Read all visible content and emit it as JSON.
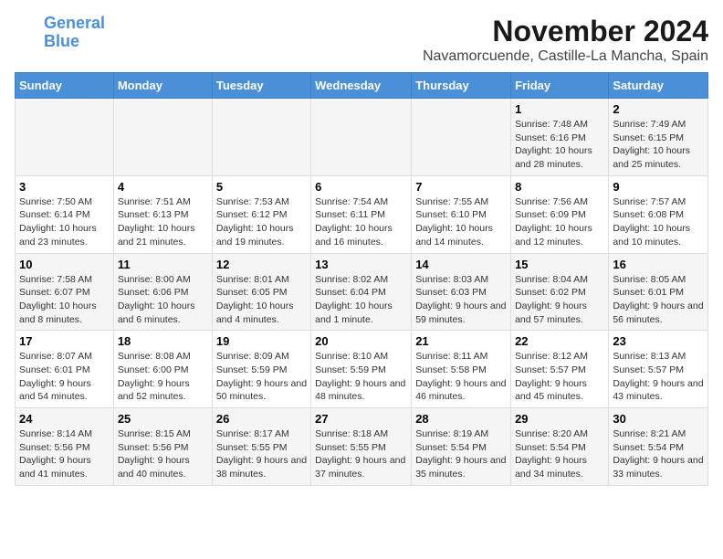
{
  "logo": {
    "line1": "General",
    "line2": "Blue"
  },
  "title": "November 2024",
  "subtitle": "Navamorcuende, Castille-La Mancha, Spain",
  "weekdays": [
    "Sunday",
    "Monday",
    "Tuesday",
    "Wednesday",
    "Thursday",
    "Friday",
    "Saturday"
  ],
  "weeks": [
    [
      {
        "day": "",
        "info": ""
      },
      {
        "day": "",
        "info": ""
      },
      {
        "day": "",
        "info": ""
      },
      {
        "day": "",
        "info": ""
      },
      {
        "day": "",
        "info": ""
      },
      {
        "day": "1",
        "info": "Sunrise: 7:48 AM\nSunset: 6:16 PM\nDaylight: 10 hours and 28 minutes."
      },
      {
        "day": "2",
        "info": "Sunrise: 7:49 AM\nSunset: 6:15 PM\nDaylight: 10 hours and 25 minutes."
      }
    ],
    [
      {
        "day": "3",
        "info": "Sunrise: 7:50 AM\nSunset: 6:14 PM\nDaylight: 10 hours and 23 minutes."
      },
      {
        "day": "4",
        "info": "Sunrise: 7:51 AM\nSunset: 6:13 PM\nDaylight: 10 hours and 21 minutes."
      },
      {
        "day": "5",
        "info": "Sunrise: 7:53 AM\nSunset: 6:12 PM\nDaylight: 10 hours and 19 minutes."
      },
      {
        "day": "6",
        "info": "Sunrise: 7:54 AM\nSunset: 6:11 PM\nDaylight: 10 hours and 16 minutes."
      },
      {
        "day": "7",
        "info": "Sunrise: 7:55 AM\nSunset: 6:10 PM\nDaylight: 10 hours and 14 minutes."
      },
      {
        "day": "8",
        "info": "Sunrise: 7:56 AM\nSunset: 6:09 PM\nDaylight: 10 hours and 12 minutes."
      },
      {
        "day": "9",
        "info": "Sunrise: 7:57 AM\nSunset: 6:08 PM\nDaylight: 10 hours and 10 minutes."
      }
    ],
    [
      {
        "day": "10",
        "info": "Sunrise: 7:58 AM\nSunset: 6:07 PM\nDaylight: 10 hours and 8 minutes."
      },
      {
        "day": "11",
        "info": "Sunrise: 8:00 AM\nSunset: 6:06 PM\nDaylight: 10 hours and 6 minutes."
      },
      {
        "day": "12",
        "info": "Sunrise: 8:01 AM\nSunset: 6:05 PM\nDaylight: 10 hours and 4 minutes."
      },
      {
        "day": "13",
        "info": "Sunrise: 8:02 AM\nSunset: 6:04 PM\nDaylight: 10 hours and 1 minute."
      },
      {
        "day": "14",
        "info": "Sunrise: 8:03 AM\nSunset: 6:03 PM\nDaylight: 9 hours and 59 minutes."
      },
      {
        "day": "15",
        "info": "Sunrise: 8:04 AM\nSunset: 6:02 PM\nDaylight: 9 hours and 57 minutes."
      },
      {
        "day": "16",
        "info": "Sunrise: 8:05 AM\nSunset: 6:01 PM\nDaylight: 9 hours and 56 minutes."
      }
    ],
    [
      {
        "day": "17",
        "info": "Sunrise: 8:07 AM\nSunset: 6:01 PM\nDaylight: 9 hours and 54 minutes."
      },
      {
        "day": "18",
        "info": "Sunrise: 8:08 AM\nSunset: 6:00 PM\nDaylight: 9 hours and 52 minutes."
      },
      {
        "day": "19",
        "info": "Sunrise: 8:09 AM\nSunset: 5:59 PM\nDaylight: 9 hours and 50 minutes."
      },
      {
        "day": "20",
        "info": "Sunrise: 8:10 AM\nSunset: 5:59 PM\nDaylight: 9 hours and 48 minutes."
      },
      {
        "day": "21",
        "info": "Sunrise: 8:11 AM\nSunset: 5:58 PM\nDaylight: 9 hours and 46 minutes."
      },
      {
        "day": "22",
        "info": "Sunrise: 8:12 AM\nSunset: 5:57 PM\nDaylight: 9 hours and 45 minutes."
      },
      {
        "day": "23",
        "info": "Sunrise: 8:13 AM\nSunset: 5:57 PM\nDaylight: 9 hours and 43 minutes."
      }
    ],
    [
      {
        "day": "24",
        "info": "Sunrise: 8:14 AM\nSunset: 5:56 PM\nDaylight: 9 hours and 41 minutes."
      },
      {
        "day": "25",
        "info": "Sunrise: 8:15 AM\nSunset: 5:56 PM\nDaylight: 9 hours and 40 minutes."
      },
      {
        "day": "26",
        "info": "Sunrise: 8:17 AM\nSunset: 5:55 PM\nDaylight: 9 hours and 38 minutes."
      },
      {
        "day": "27",
        "info": "Sunrise: 8:18 AM\nSunset: 5:55 PM\nDaylight: 9 hours and 37 minutes."
      },
      {
        "day": "28",
        "info": "Sunrise: 8:19 AM\nSunset: 5:54 PM\nDaylight: 9 hours and 35 minutes."
      },
      {
        "day": "29",
        "info": "Sunrise: 8:20 AM\nSunset: 5:54 PM\nDaylight: 9 hours and 34 minutes."
      },
      {
        "day": "30",
        "info": "Sunrise: 8:21 AM\nSunset: 5:54 PM\nDaylight: 9 hours and 33 minutes."
      }
    ]
  ]
}
